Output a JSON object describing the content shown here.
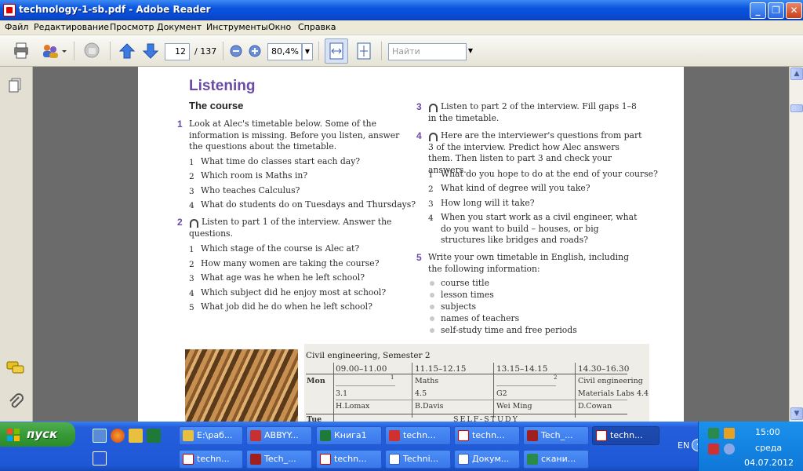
{
  "window": {
    "title": "technology-1-sb.pdf - Adobe Reader"
  },
  "menu": [
    "Файл",
    "Редактирование",
    "Просмотр",
    "Документ",
    "Инструменты",
    "Окно",
    "Справка"
  ],
  "toolbar": {
    "page_current": "12",
    "page_total": "/  137",
    "zoom": "80,4%",
    "search_placeholder": "Найти"
  },
  "doc": {
    "heading": "Listening",
    "subheading": "The course",
    "ex1": {
      "num": "1",
      "text": "Look at Alec's timetable below. Some of the information is missing. Before you listen, answer the questions about the timetable.",
      "items": [
        "What time do classes start each day?",
        "Which room is Maths in?",
        "Who teaches Calculus?",
        "What do students do on Tuesdays and Thursdays?"
      ]
    },
    "ex2": {
      "num": "2",
      "text": "Listen to part 1 of the interview. Answer the questions.",
      "items": [
        "Which stage of the course is Alec at?",
        "How many women are taking the course?",
        "What age was he when he left school?",
        "Which subject did he enjoy most at school?",
        "What job did he do when he left school?"
      ]
    },
    "ex3": {
      "num": "3",
      "text": "Listen to part 2 of the interview. Fill gaps 1–8 in the timetable."
    },
    "ex4": {
      "num": "4",
      "text": "Here are the interviewer's questions from part 3 of the interview. Predict how Alec answers them. Then listen to part 3 and check your answers.",
      "items": [
        "What do you hope to do at the end of your course?",
        "What kind of degree will you take?",
        "How long will it take?",
        "When you start work as a civil engineer, what do you want to build – houses, or big structures like bridges and roads?"
      ]
    },
    "ex5": {
      "num": "5",
      "text": "Write your own timetable in English, including the following information:",
      "bullets": [
        "course title",
        "lesson times",
        "subjects",
        "names of teachers",
        "self-study time and free periods"
      ]
    },
    "timetable": {
      "title": "Civil engineering, Semester 2",
      "times": [
        "09.00–11.00",
        "11.15–12.15",
        "13.15–14.15",
        "14.30–16.30"
      ],
      "mon_label": "Mon",
      "mon": [
        "",
        "Maths",
        "",
        "Civil engineering"
      ],
      "gaps": [
        "1",
        "2"
      ],
      "rooms": [
        "3.1",
        "4.5",
        "G2",
        "Materials Labs 4.4"
      ],
      "teachers": [
        "H.Lomax",
        "B.Davis",
        "Wei Ming",
        "D.Cowan"
      ],
      "tue_label": "Tue",
      "tue": "SELF-STUDY"
    }
  },
  "taskbar": {
    "start": "пуск",
    "row1": [
      "E:\\раб...",
      "ABBYY...",
      "Книга1",
      "techn...",
      "techn...",
      "Tech_...",
      "techn..."
    ],
    "row2": [
      "techn...",
      "Tech_...",
      "techn...",
      "Techni...",
      "Докум...",
      "скани..."
    ],
    "lang": "EN",
    "time": "15:00",
    "day": "среда",
    "date": "04.07.2012"
  },
  "colors": {
    "accent_purple": "#6a4aa6",
    "title_blue": "#0a54e0",
    "start_green": "#379a37"
  }
}
